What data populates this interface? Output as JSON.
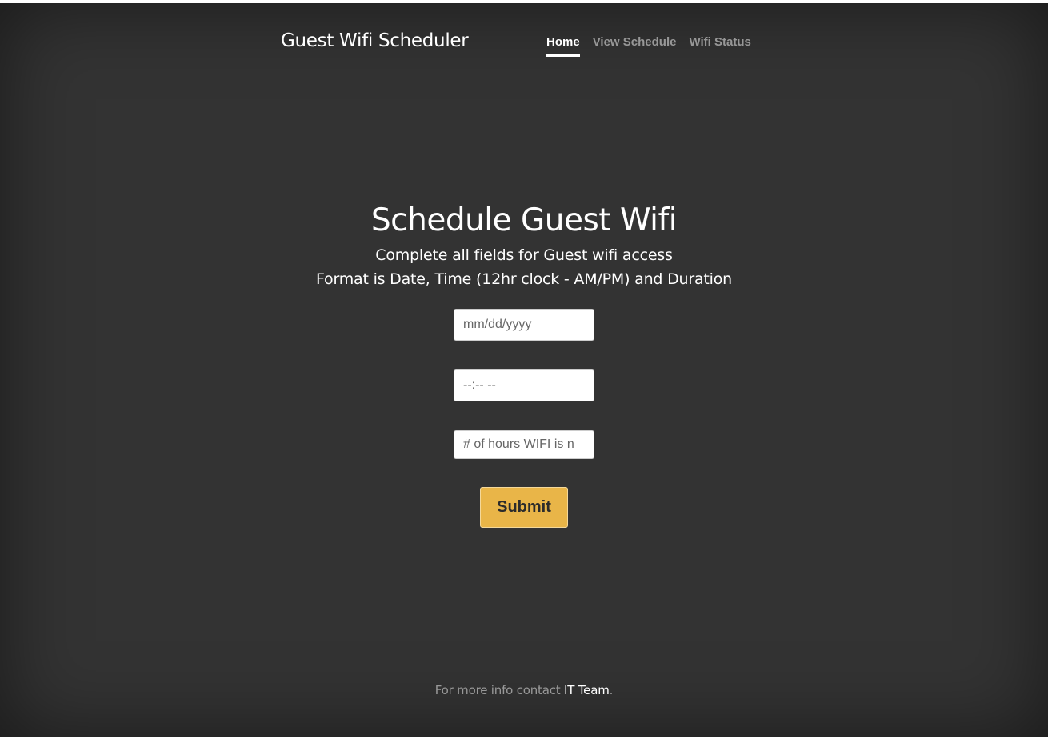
{
  "masthead": {
    "brand": "Guest Wifi Scheduler",
    "nav": [
      {
        "label": "Home",
        "active": true
      },
      {
        "label": "View Schedule",
        "active": false
      },
      {
        "label": "Wifi Status",
        "active": false
      }
    ]
  },
  "main": {
    "heading": "Schedule Guest Wifi",
    "lead_line1": "Complete all fields for Guest wifi access",
    "lead_line2": "Format is Date, Time (12hr clock - AM/PM) and Duration"
  },
  "form": {
    "date_placeholder": "mm/dd/yyyy",
    "time_placeholder": "--:-- --",
    "hours_placeholder": "# of hours WIFI is n",
    "submit_label": "Submit"
  },
  "footer": {
    "text_prefix": "For more info contact ",
    "link_label": "IT Team",
    "text_suffix": "."
  },
  "colors": {
    "background": "#333333",
    "accent": "#e9b548",
    "text": "#ffffff"
  }
}
